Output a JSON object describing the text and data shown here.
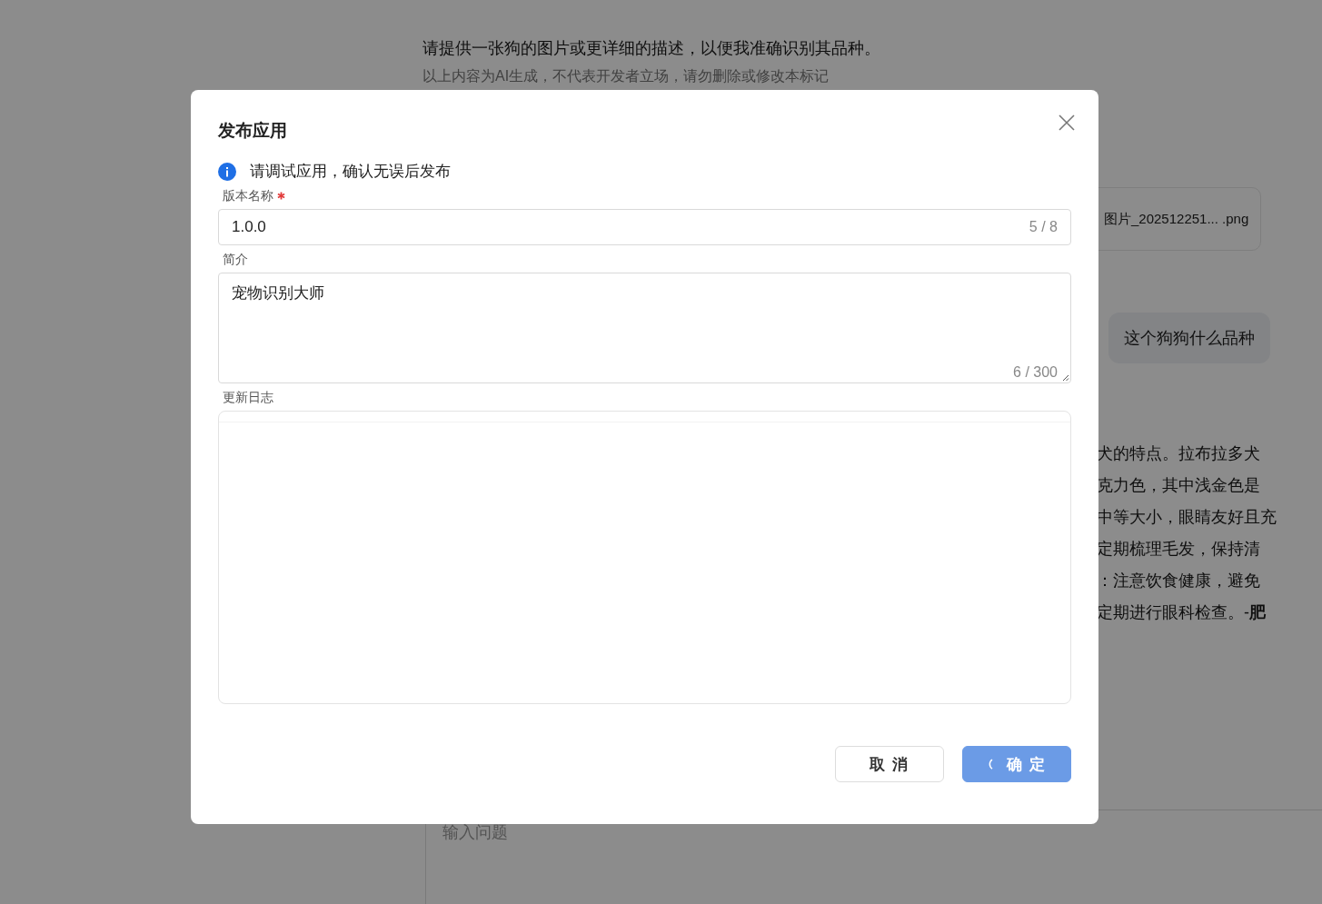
{
  "background": {
    "reply_text": "请提供一张狗的图片或更详细的描述，以便我准确识别其品种。",
    "ai_notice": "以上内容为AI生成，不代表开发者立场，请勿删除或修改本标记",
    "attachment": "图片_202512251... .png",
    "user_message": "这个狗狗什么品种",
    "answer_lines": [
      "犬的特点。拉布拉多犬",
      "克力色，其中浅金色是",
      "中等大小，眼睛友好且充",
      "定期梳理毛发，保持清",
      "：注意饮食健康，避免",
      "定期进行眼科检查。-**肥**"
    ],
    "input": {
      "placeholder": "输入问题"
    }
  },
  "dialog": {
    "title": "发布应用",
    "notice": "请调试应用，确认无误后发布",
    "fields": [
      {
        "kind": "input",
        "label": "版本名称",
        "required": true,
        "value": "1.0.0",
        "count": "5 / 8"
      },
      {
        "kind": "textarea",
        "label": "简介",
        "required": false,
        "value": "宠物识别大师",
        "count": "6 / 300"
      },
      {
        "kind": "editor",
        "label": "更新日志",
        "required": false
      }
    ],
    "buttons": [
      {
        "label": "取 消",
        "primary": false,
        "loading": false
      },
      {
        "label": "确 定",
        "primary": true,
        "loading": true
      }
    ]
  }
}
